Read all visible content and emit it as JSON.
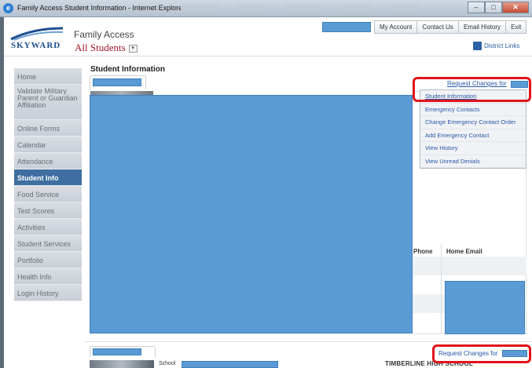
{
  "window": {
    "title": "Family Access Student Information - Internet Explorer",
    "controls": {
      "minimize": "–",
      "maximize": "□",
      "close": "✕"
    }
  },
  "header": {
    "logo_text": "SKYWARD",
    "app_title": "Family Access",
    "student_selector": "All Students",
    "district_links": "District Links"
  },
  "topnav": [
    "My Account",
    "Contact Us",
    "Email History",
    "Exit"
  ],
  "sidebar": {
    "items": [
      {
        "label": "Home",
        "active": false
      },
      {
        "label": "Validate Military Parent or Guardian Affiliation",
        "active": false
      },
      {
        "label": "Online Forms",
        "active": false
      },
      {
        "label": "Calendar",
        "active": false
      },
      {
        "label": "Attendance",
        "active": false
      },
      {
        "label": "Student Info",
        "active": true
      },
      {
        "label": "Food Service",
        "active": false
      },
      {
        "label": "Test Scores",
        "active": false
      },
      {
        "label": "Activities",
        "active": false
      },
      {
        "label": "Student Services",
        "active": false
      },
      {
        "label": "Portfolio",
        "active": false
      },
      {
        "label": "Health Info",
        "active": false
      },
      {
        "label": "Login History",
        "active": false
      }
    ]
  },
  "main": {
    "page_title": "Student Information",
    "table_headers": {
      "phone": "Phone",
      "home_email": "Home Email"
    }
  },
  "request_menu": {
    "link_label": "Request Changes for",
    "items": [
      "Student Information",
      "Emergency Contacts",
      "Change Emergency Contact Order",
      "Add Emergency Contact",
      "View History",
      "View Unread Denials"
    ]
  },
  "lower": {
    "request_link": "Request Changes for",
    "school_label": "School",
    "school_name": "TIMBERLINE HIGH SCHOOL"
  },
  "colors": {
    "redaction": "#5b9bd5",
    "highlight_box": "#e0151b",
    "active_nav": "#3f6ea0",
    "link": "#2a57a6"
  }
}
